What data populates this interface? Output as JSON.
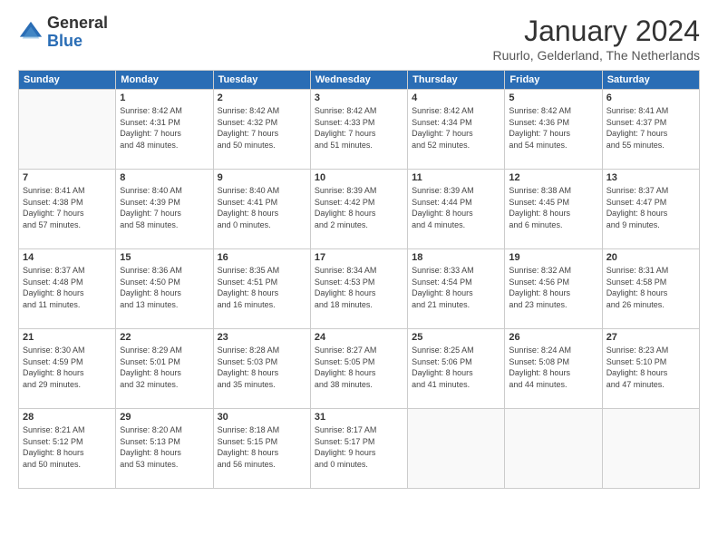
{
  "header": {
    "logo": {
      "general": "General",
      "blue": "Blue"
    },
    "title": "January 2024",
    "location": "Ruurlo, Gelderland, The Netherlands"
  },
  "calendar": {
    "weekdays": [
      "Sunday",
      "Monday",
      "Tuesday",
      "Wednesday",
      "Thursday",
      "Friday",
      "Saturday"
    ],
    "weeks": [
      [
        {
          "day": "",
          "info": ""
        },
        {
          "day": "1",
          "info": "Sunrise: 8:42 AM\nSunset: 4:31 PM\nDaylight: 7 hours\nand 48 minutes."
        },
        {
          "day": "2",
          "info": "Sunrise: 8:42 AM\nSunset: 4:32 PM\nDaylight: 7 hours\nand 50 minutes."
        },
        {
          "day": "3",
          "info": "Sunrise: 8:42 AM\nSunset: 4:33 PM\nDaylight: 7 hours\nand 51 minutes."
        },
        {
          "day": "4",
          "info": "Sunrise: 8:42 AM\nSunset: 4:34 PM\nDaylight: 7 hours\nand 52 minutes."
        },
        {
          "day": "5",
          "info": "Sunrise: 8:42 AM\nSunset: 4:36 PM\nDaylight: 7 hours\nand 54 minutes."
        },
        {
          "day": "6",
          "info": "Sunrise: 8:41 AM\nSunset: 4:37 PM\nDaylight: 7 hours\nand 55 minutes."
        }
      ],
      [
        {
          "day": "7",
          "info": "Sunrise: 8:41 AM\nSunset: 4:38 PM\nDaylight: 7 hours\nand 57 minutes."
        },
        {
          "day": "8",
          "info": "Sunrise: 8:40 AM\nSunset: 4:39 PM\nDaylight: 7 hours\nand 58 minutes."
        },
        {
          "day": "9",
          "info": "Sunrise: 8:40 AM\nSunset: 4:41 PM\nDaylight: 8 hours\nand 0 minutes."
        },
        {
          "day": "10",
          "info": "Sunrise: 8:39 AM\nSunset: 4:42 PM\nDaylight: 8 hours\nand 2 minutes."
        },
        {
          "day": "11",
          "info": "Sunrise: 8:39 AM\nSunset: 4:44 PM\nDaylight: 8 hours\nand 4 minutes."
        },
        {
          "day": "12",
          "info": "Sunrise: 8:38 AM\nSunset: 4:45 PM\nDaylight: 8 hours\nand 6 minutes."
        },
        {
          "day": "13",
          "info": "Sunrise: 8:37 AM\nSunset: 4:47 PM\nDaylight: 8 hours\nand 9 minutes."
        }
      ],
      [
        {
          "day": "14",
          "info": "Sunrise: 8:37 AM\nSunset: 4:48 PM\nDaylight: 8 hours\nand 11 minutes."
        },
        {
          "day": "15",
          "info": "Sunrise: 8:36 AM\nSunset: 4:50 PM\nDaylight: 8 hours\nand 13 minutes."
        },
        {
          "day": "16",
          "info": "Sunrise: 8:35 AM\nSunset: 4:51 PM\nDaylight: 8 hours\nand 16 minutes."
        },
        {
          "day": "17",
          "info": "Sunrise: 8:34 AM\nSunset: 4:53 PM\nDaylight: 8 hours\nand 18 minutes."
        },
        {
          "day": "18",
          "info": "Sunrise: 8:33 AM\nSunset: 4:54 PM\nDaylight: 8 hours\nand 21 minutes."
        },
        {
          "day": "19",
          "info": "Sunrise: 8:32 AM\nSunset: 4:56 PM\nDaylight: 8 hours\nand 23 minutes."
        },
        {
          "day": "20",
          "info": "Sunrise: 8:31 AM\nSunset: 4:58 PM\nDaylight: 8 hours\nand 26 minutes."
        }
      ],
      [
        {
          "day": "21",
          "info": "Sunrise: 8:30 AM\nSunset: 4:59 PM\nDaylight: 8 hours\nand 29 minutes."
        },
        {
          "day": "22",
          "info": "Sunrise: 8:29 AM\nSunset: 5:01 PM\nDaylight: 8 hours\nand 32 minutes."
        },
        {
          "day": "23",
          "info": "Sunrise: 8:28 AM\nSunset: 5:03 PM\nDaylight: 8 hours\nand 35 minutes."
        },
        {
          "day": "24",
          "info": "Sunrise: 8:27 AM\nSunset: 5:05 PM\nDaylight: 8 hours\nand 38 minutes."
        },
        {
          "day": "25",
          "info": "Sunrise: 8:25 AM\nSunset: 5:06 PM\nDaylight: 8 hours\nand 41 minutes."
        },
        {
          "day": "26",
          "info": "Sunrise: 8:24 AM\nSunset: 5:08 PM\nDaylight: 8 hours\nand 44 minutes."
        },
        {
          "day": "27",
          "info": "Sunrise: 8:23 AM\nSunset: 5:10 PM\nDaylight: 8 hours\nand 47 minutes."
        }
      ],
      [
        {
          "day": "28",
          "info": "Sunrise: 8:21 AM\nSunset: 5:12 PM\nDaylight: 8 hours\nand 50 minutes."
        },
        {
          "day": "29",
          "info": "Sunrise: 8:20 AM\nSunset: 5:13 PM\nDaylight: 8 hours\nand 53 minutes."
        },
        {
          "day": "30",
          "info": "Sunrise: 8:18 AM\nSunset: 5:15 PM\nDaylight: 8 hours\nand 56 minutes."
        },
        {
          "day": "31",
          "info": "Sunrise: 8:17 AM\nSunset: 5:17 PM\nDaylight: 9 hours\nand 0 minutes."
        },
        {
          "day": "",
          "info": ""
        },
        {
          "day": "",
          "info": ""
        },
        {
          "day": "",
          "info": ""
        }
      ]
    ]
  }
}
